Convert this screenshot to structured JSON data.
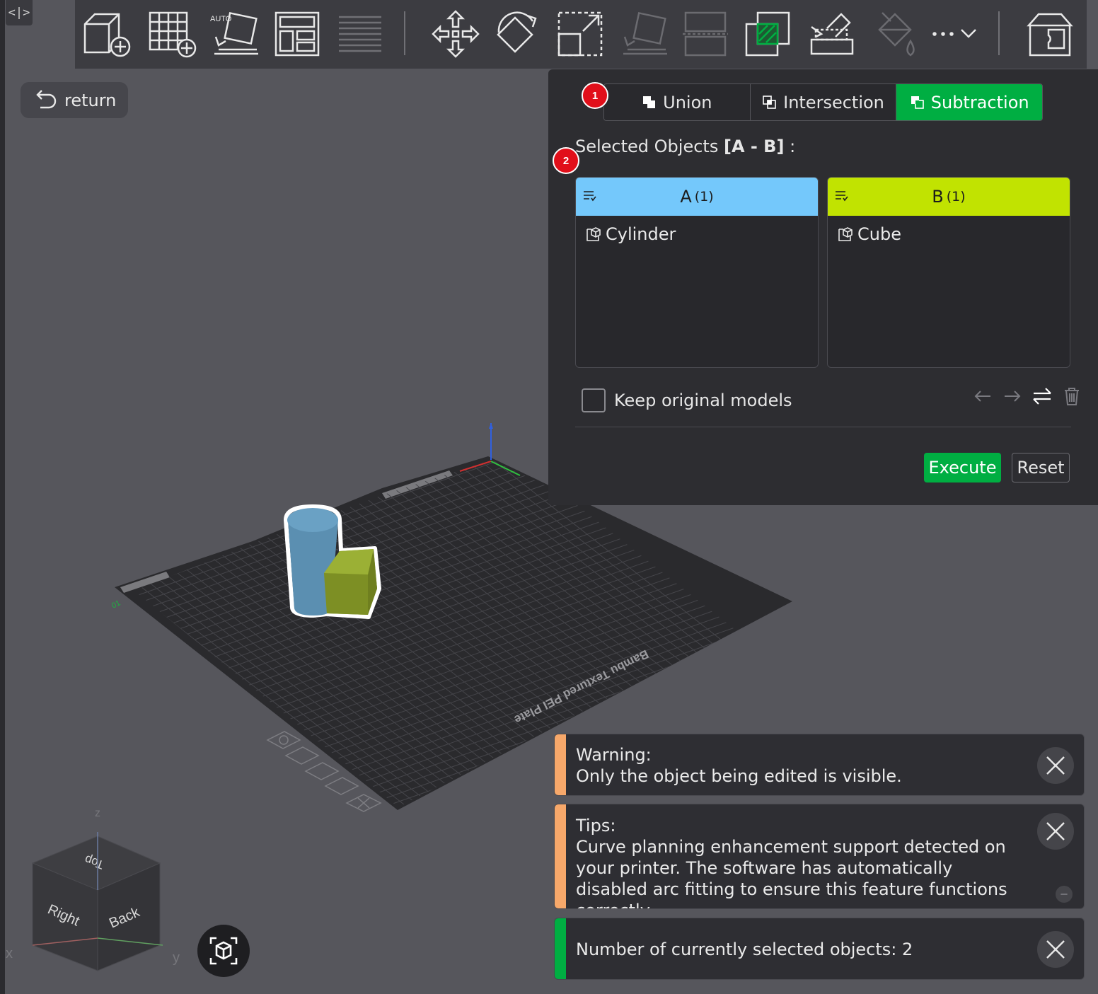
{
  "return_label": "return",
  "toolbar": {
    "tools": [
      "add-cube-icon",
      "add-plate-icon",
      "auto-orient-icon",
      "arrange-icon",
      "layers-icon",
      "move-icon",
      "rotate-icon",
      "scale-icon",
      "lay-on-face-icon",
      "cut-icon",
      "boolean-icon",
      "support-paint-icon",
      "color-paint-icon",
      "more-icon",
      "assembly-view-icon"
    ],
    "auto_label": "AUTO",
    "more_label": "···"
  },
  "boolean_panel": {
    "badge_1": "1",
    "badge_2": "2",
    "tabs": [
      {
        "label": "Union",
        "active": false
      },
      {
        "label": "Intersection",
        "active": false
      },
      {
        "label": "Subtraction",
        "active": true
      }
    ],
    "selected_prefix": "Selected Objects ",
    "selected_formula": "[A - B]",
    "selected_suffix": " :",
    "column_a": {
      "title": "A",
      "count": "(1)",
      "color": "#74c8fb",
      "items": [
        "Cylinder"
      ]
    },
    "column_b": {
      "title": "B",
      "count": "(1)",
      "color": "#c1e301",
      "items": [
        "Cube"
      ]
    },
    "keep_original_label": "Keep original models",
    "keep_original_checked": false,
    "execute_label": "Execute",
    "reset_label": "Reset"
  },
  "notifications": [
    {
      "title": "Warning:",
      "body": "Only the object being edited is visible.",
      "color": "#f7a86a"
    },
    {
      "title": "Tips:",
      "body": "Curve planning enhancement support detected on your printer. The software has automatically disabled arc fitting to ensure this feature functions correctly.",
      "color": "#f7a86a"
    },
    {
      "title": "",
      "body": "Number of currently selected objects: 2",
      "color": "#00ae42"
    }
  ],
  "scene": {
    "plate_label": "Bambu Textured PEI Plate",
    "plate_number": "01",
    "view_cube": {
      "top": "Top",
      "right": "Right",
      "back": "Back",
      "axis_x": "x",
      "axis_y": "y",
      "axis_z": "z"
    }
  },
  "colors": {
    "accent": "#00ae42",
    "cylinder": "#5b8fb1",
    "cube": "#8ea02c"
  }
}
